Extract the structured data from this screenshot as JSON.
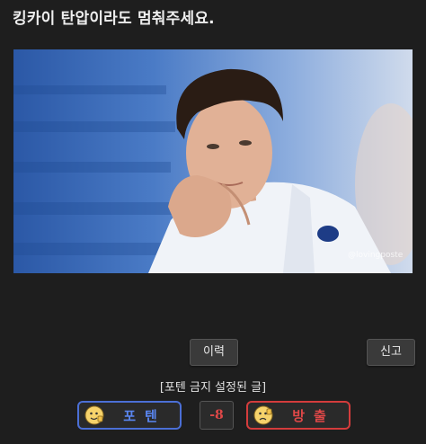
{
  "post": {
    "title": "킹카이 탄압이라도 멈춰주세요.",
    "image_watermark": "@lovingposte"
  },
  "actions": {
    "history_label": "이력",
    "report_label": "신고"
  },
  "vote": {
    "notice": "[포텐 금지 설정된 글]",
    "up_label": "포텐",
    "down_label": "방출",
    "score": "-8"
  },
  "colors": {
    "up_accent": "#4b6fd6",
    "down_accent": "#d43c3c",
    "background": "#1e1e1e"
  }
}
